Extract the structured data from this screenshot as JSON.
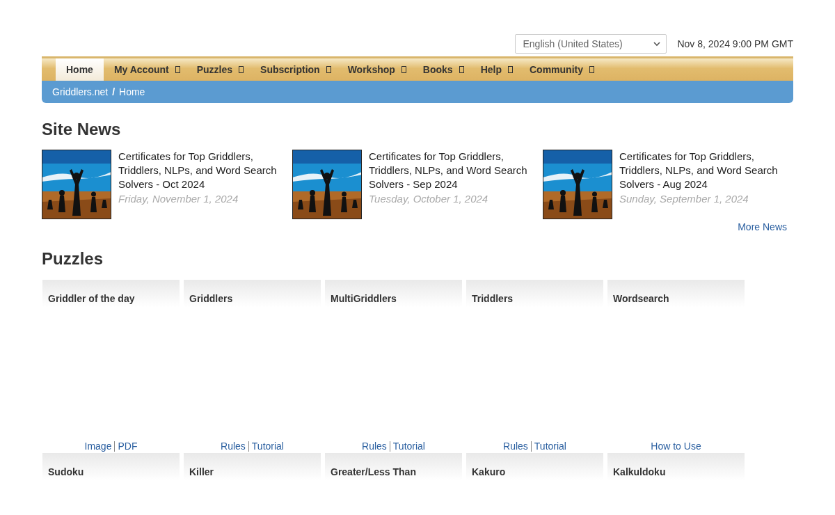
{
  "language_select": {
    "value": "English (United States)"
  },
  "datetime": "Nov 8, 2024 9:00 PM GMT",
  "nav": [
    {
      "label": "Home",
      "selected": true,
      "has_menu": false
    },
    {
      "label": "My Account",
      "selected": false,
      "has_menu": true
    },
    {
      "label": "Puzzles",
      "selected": false,
      "has_menu": true
    },
    {
      "label": "Subscription",
      "selected": false,
      "has_menu": true
    },
    {
      "label": "Workshop",
      "selected": false,
      "has_menu": true
    },
    {
      "label": "Books",
      "selected": false,
      "has_menu": true
    },
    {
      "label": "Help",
      "selected": false,
      "has_menu": true
    },
    {
      "label": "Community",
      "selected": false,
      "has_menu": true
    }
  ],
  "breadcrumb": {
    "items": [
      "Griddlers.net",
      "Home"
    ],
    "separator": "/"
  },
  "site_news": {
    "heading": "Site News",
    "items": [
      {
        "title": "Certificates for Top Griddlers, Triddlers, NLPs, and Word Search Solvers - Oct 2024",
        "date": "Friday, November 1, 2024"
      },
      {
        "title": "Certificates for Top Griddlers, Triddlers, NLPs, and Word Search Solvers - Sep 2024",
        "date": "Tuesday, October 1, 2024"
      },
      {
        "title": "Certificates for Top Griddlers, Triddlers, NLPs, and Word Search Solvers - Aug 2024",
        "date": "Sunday, September 1, 2024"
      }
    ],
    "more_link": "More News"
  },
  "puzzles": {
    "heading": "Puzzles",
    "rows": [
      [
        {
          "title": "Griddler of the day",
          "links": [
            "Image",
            "PDF"
          ]
        },
        {
          "title": "Griddlers",
          "links": [
            "Rules",
            "Tutorial"
          ]
        },
        {
          "title": "MultiGriddlers",
          "links": [
            "Rules",
            "Tutorial"
          ]
        },
        {
          "title": "Triddlers",
          "links": [
            "Rules",
            "Tutorial"
          ]
        },
        {
          "title": "Wordsearch",
          "links": [
            "How to Use"
          ]
        }
      ],
      [
        {
          "title": "Sudoku"
        },
        {
          "title": "Killer"
        },
        {
          "title": "Greater/Less Than"
        },
        {
          "title": "Kakuro"
        },
        {
          "title": "Kalkuldoku"
        }
      ]
    ]
  }
}
